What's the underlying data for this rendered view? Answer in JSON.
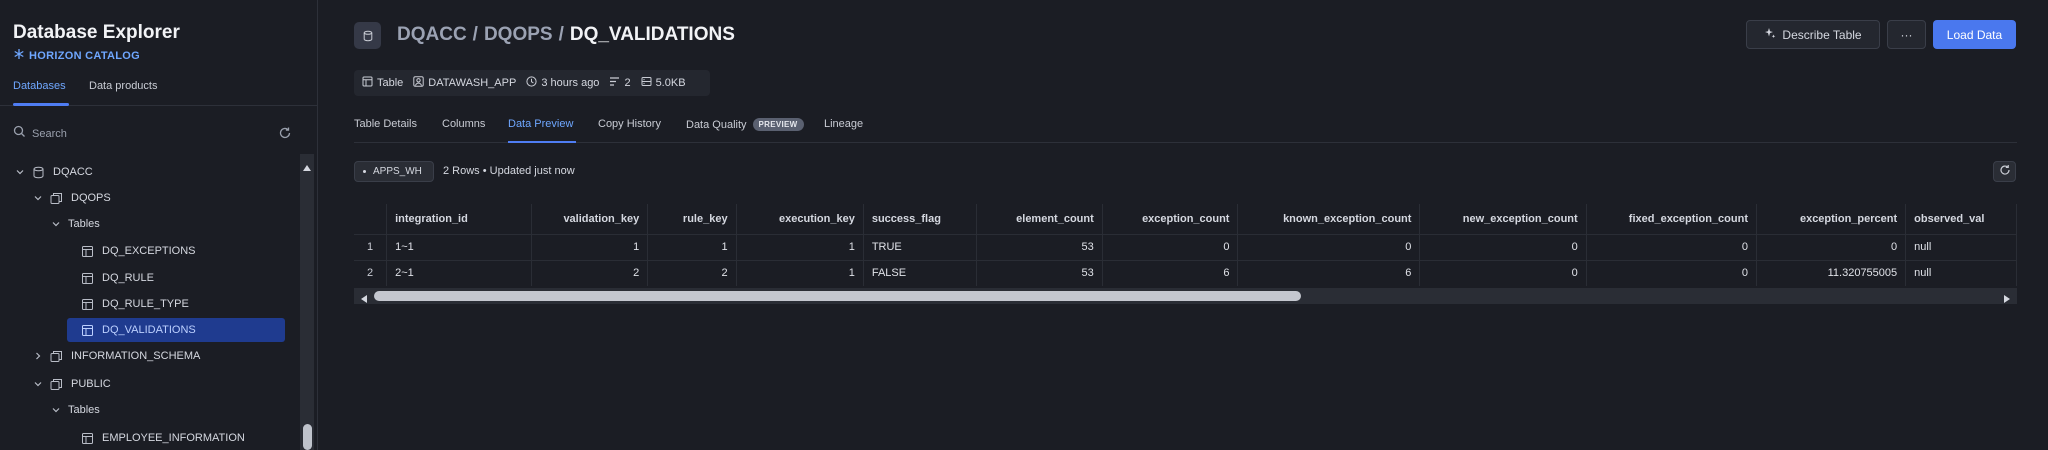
{
  "sidebar": {
    "title": "Database Explorer",
    "subtitle": "HORIZON CATALOG",
    "tabs": [
      {
        "label": "Databases",
        "active": true
      },
      {
        "label": "Data products",
        "active": false
      }
    ],
    "search_placeholder": "Search",
    "tree": [
      {
        "label": "DQACC",
        "level": 0,
        "expanded": true,
        "kind": "database"
      },
      {
        "label": "DQOPS",
        "level": 1,
        "expanded": true,
        "kind": "schema"
      },
      {
        "label": "Tables",
        "level": 2,
        "expanded": true,
        "kind": "folder"
      },
      {
        "label": "DQ_EXCEPTIONS",
        "level": 3,
        "kind": "table"
      },
      {
        "label": "DQ_RULE",
        "level": 3,
        "kind": "table"
      },
      {
        "label": "DQ_RULE_TYPE",
        "level": 3,
        "kind": "table"
      },
      {
        "label": "DQ_VALIDATIONS",
        "level": 3,
        "kind": "table",
        "selected": true
      },
      {
        "label": "INFORMATION_SCHEMA",
        "level": 1,
        "expanded": false,
        "kind": "schema"
      },
      {
        "label": "PUBLIC",
        "level": 1,
        "expanded": true,
        "kind": "schema"
      },
      {
        "label": "Tables",
        "level": 2,
        "expanded": true,
        "kind": "folder"
      },
      {
        "label": "EMPLOYEE_INFORMATION",
        "level": 3,
        "kind": "table"
      }
    ]
  },
  "header": {
    "breadcrumb": [
      "DQACC",
      "DQOPS",
      "DQ_VALIDATIONS"
    ],
    "separator": "/",
    "describe_label": "Describe Table",
    "more_label": "···",
    "load_label": "Load Data"
  },
  "meta": {
    "type": "Table",
    "owner": "DATAWASH_APP",
    "updated": "3 hours ago",
    "rows": "2",
    "size": "5.0KB"
  },
  "tabs": [
    {
      "label": "Table Details",
      "active": false
    },
    {
      "label": "Columns",
      "active": false
    },
    {
      "label": "Data Preview",
      "active": true
    },
    {
      "label": "Copy History",
      "active": false
    },
    {
      "label": "Data Quality",
      "active": false,
      "badge": "PREVIEW"
    },
    {
      "label": "Lineage",
      "active": false
    }
  ],
  "preview": {
    "warehouse": "APPS_WH",
    "info": "2 Rows • Updated just now",
    "columns": [
      "integration_id",
      "validation_key",
      "rule_key",
      "execution_key",
      "success_flag",
      "element_count",
      "exception_count",
      "known_exception_count",
      "new_exception_count",
      "fixed_exception_count",
      "exception_percent",
      "observed_val"
    ],
    "rows": [
      {
        "idx": "1",
        "cells": [
          "1~1",
          "1",
          "1",
          "1",
          "TRUE",
          "53",
          "0",
          "0",
          "0",
          "0",
          "0",
          "null"
        ]
      },
      {
        "idx": "2",
        "cells": [
          "2~1",
          "2",
          "2",
          "1",
          "FALSE",
          "53",
          "6",
          "6",
          "0",
          "0",
          "11.320755005",
          "null"
        ]
      }
    ]
  },
  "colors": {
    "accent": "#4a78ee",
    "selected_bg": "#1f3b8f",
    "link": "#6fa7ff"
  }
}
